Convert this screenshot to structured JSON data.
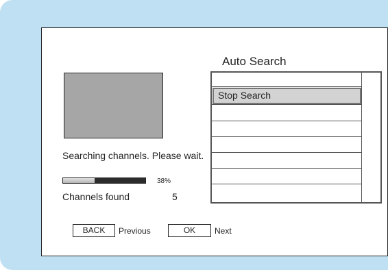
{
  "menu": {
    "title": "Auto Search",
    "selected_item": "Stop Search"
  },
  "status": {
    "message": "Searching channels. Please wait.",
    "progress_percent": 38,
    "progress_label": "38%",
    "channels_found_label": "Channels found",
    "channels_found_count": "5"
  },
  "footer": {
    "back_key": "BACK",
    "back_text": "Previous",
    "ok_key": "OK",
    "ok_text": "Next"
  },
  "colors": {
    "frame_background": "#bfe0f2",
    "preview_fill": "#a6a6a6",
    "selection_fill": "#d3d3d3"
  }
}
